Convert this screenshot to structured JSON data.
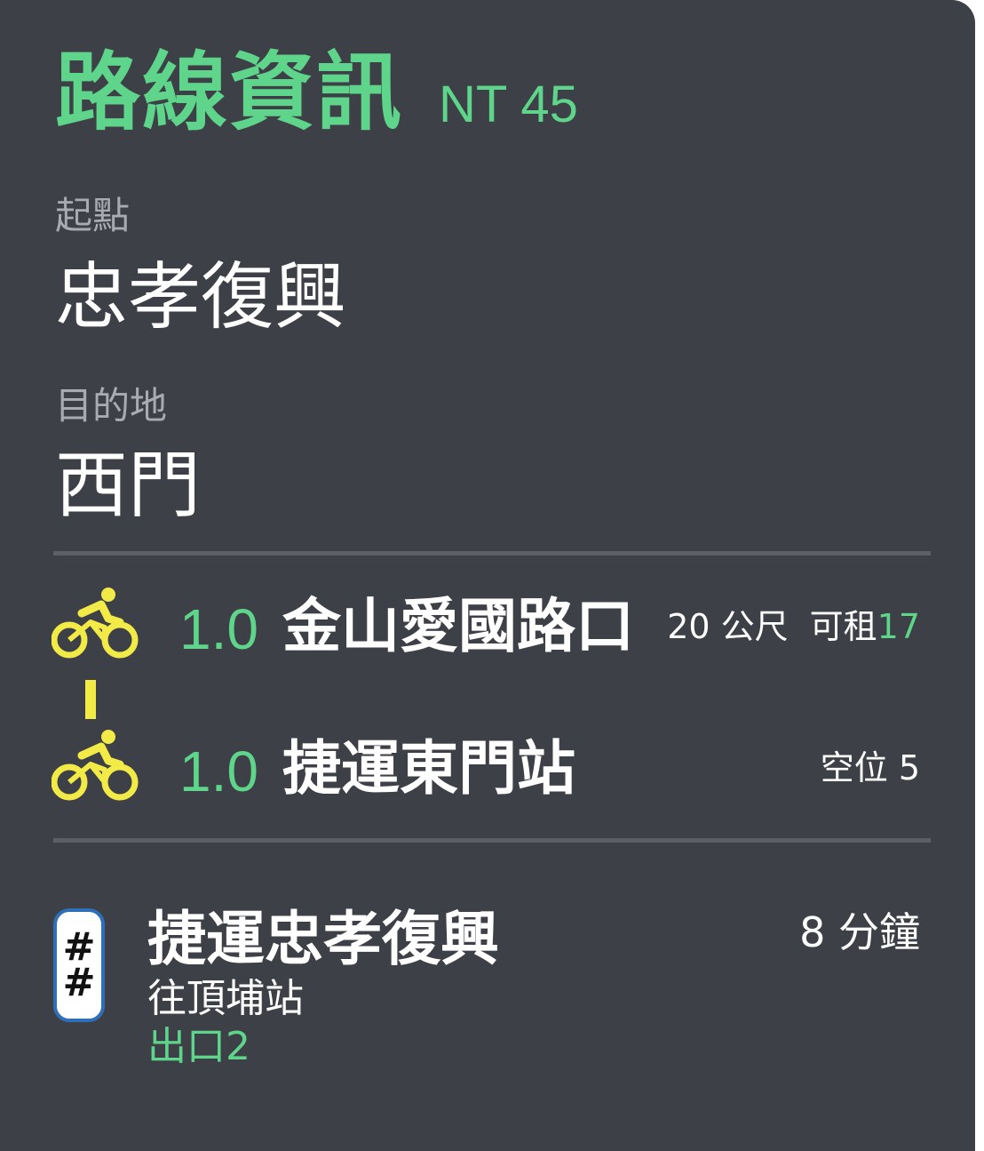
{
  "header": {
    "title": "路線資訊",
    "fare": "NT 45"
  },
  "origin": {
    "label": "起點",
    "name": "忠孝復興"
  },
  "destination": {
    "label": "目的地",
    "name": "西門"
  },
  "bike_segments": [
    {
      "icon": "bicycle-icon",
      "distance": "1.0",
      "station": "金山愛國路口",
      "walk": "20 公尺",
      "status_label": "可租",
      "status_value": "17"
    },
    {
      "icon": "bicycle-icon",
      "distance": "1.0",
      "station": "捷運東門站",
      "status_label": "空位 5"
    }
  ],
  "metro": {
    "icon": "metro-icon",
    "icon_glyph": "#",
    "station": "捷運忠孝復興",
    "direction": "往頂埔站",
    "exit": "出口2",
    "walk_time": "8 分鐘"
  },
  "colors": {
    "background": "#3e4047",
    "accent_green": "#5ed58a",
    "bike_yellow": "#f2ea47",
    "label_gray": "#a8abb1",
    "metro_blue": "#2f6fb7"
  }
}
